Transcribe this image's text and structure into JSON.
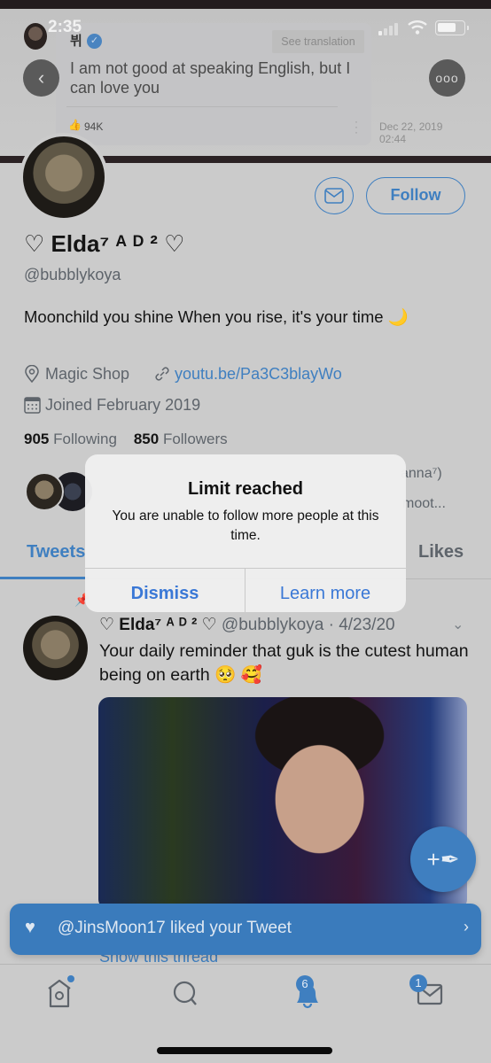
{
  "status_bar": {
    "time": "2:35"
  },
  "header_banner": {
    "name": "뷔",
    "see_translation": "See translation",
    "text": "I am not good at speaking English, but I can love you",
    "likes": "94K",
    "date_line1": "Dec 22, 2019",
    "date_line2": "02:44"
  },
  "nav": {
    "back_icon": "‹",
    "more_icon": "ooo"
  },
  "profile": {
    "follow_label": "Follow",
    "display_name": "♡ Elda⁷ ᴬ ᴰ ² ♡",
    "handle": "@bubblykoya",
    "bio": "Moonchild you shine When you rise, it's your time 🌙",
    "location": "Magic Shop",
    "website": "youtu.be/Pa3C3blayWo",
    "joined": "Joined February 2019",
    "following_count": "905",
    "following_label": "Following",
    "followers_count": "850",
    "followers_label": "Followers",
    "followers_you_know_line1": "anna⁷)",
    "followers_you_know_line2": "moot..."
  },
  "tabs": [
    {
      "label": "Tweets",
      "active": true
    },
    {
      "label": "Likes",
      "active": false
    }
  ],
  "pinned_tweet": {
    "author": "♡ Elda⁷ ᴬ ᴰ ² ♡",
    "handle_date": "@bubblykoya · 4/23/20",
    "text": "Your daily reminder that guk is the cutest human being on earth 🥺 🥰",
    "show_thread": "Show this thread"
  },
  "toast": {
    "text": "@JinsMoon17 liked your Tweet"
  },
  "bottom_nav": {
    "notifications_badge": "6",
    "messages_badge": "1"
  },
  "alert": {
    "title": "Limit reached",
    "message": "You are unable to follow more people at this time.",
    "dismiss": "Dismiss",
    "learn_more": "Learn more"
  },
  "colors": {
    "accent": "#3f7fc0",
    "toast": "#3a7bbc",
    "alert_button": "#3a78d6"
  }
}
